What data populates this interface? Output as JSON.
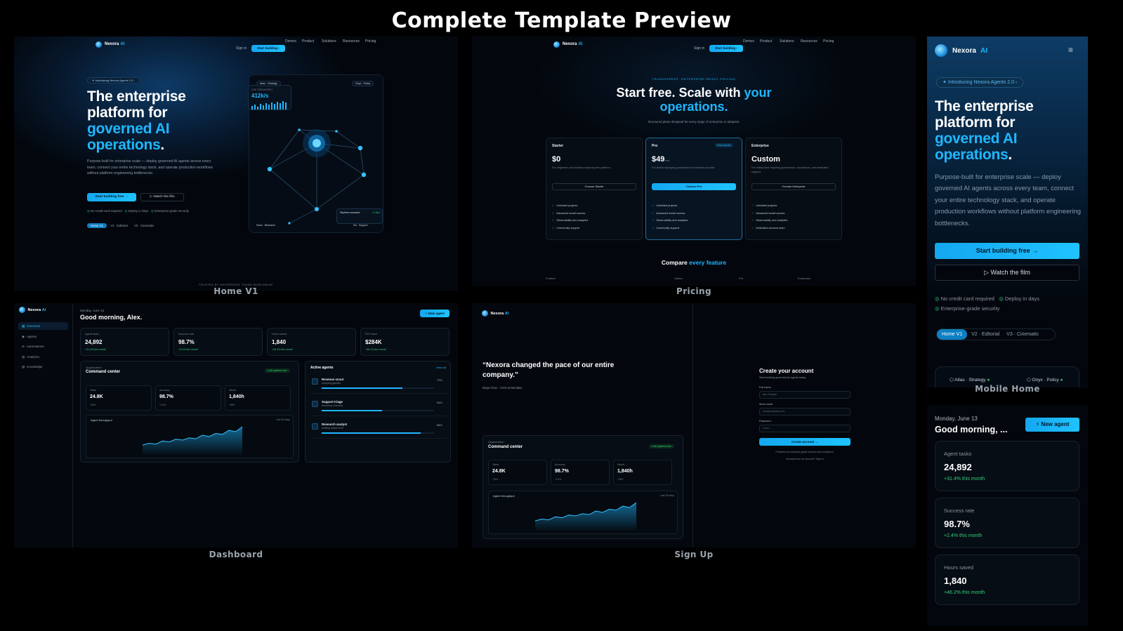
{
  "page_title": "Complete Template Preview",
  "brand": {
    "name": "Nexora",
    "suffix": "AI"
  },
  "accent": "#1fb7ff",
  "captions": {
    "home": "Home V1",
    "pricing": "Pricing",
    "dashboard": "Dashboard",
    "signup": "Sign Up",
    "mobile": "Mobile Home"
  },
  "nav": {
    "links": [
      "Demos",
      "Product",
      "Solutions",
      "Resources",
      "Pricing"
    ],
    "signin": "Sign in",
    "start": "Start building"
  },
  "home": {
    "badge": "Introducing Nexora Agents 2.0",
    "h1_a": "The enterprise",
    "h1_b": "platform for",
    "h1_c": "governed AI",
    "h1_d": "operations",
    "h1_dot": ".",
    "sub": "Purpose-built for enterprise scale — deploy governed AI agents across every team, connect your entire technology stack, and operate production workflows without platform engineering bottlenecks.",
    "cta_primary": "Start building free",
    "cta_secondary": "Watch the film",
    "checks": [
      "No credit card required",
      "Deploy in days",
      "Enterprise-grade security"
    ],
    "variants": [
      "Home V1",
      "V2 · Editorial",
      "V3 · Cinematic"
    ],
    "viz_top_left": "Atlas · Strategy",
    "viz_top_right": "Onyx · Policy",
    "viz_metric": "412k/s",
    "viz_metric_label": "LIVE THROUGHPUT",
    "viz_bottom_left": "Nova · Research",
    "viz_bottom_right": "Iris · Support",
    "viz_pipeline": "Pipeline executed",
    "viz_pipeline_badge": "+1.2k/s",
    "trusted": "TRUSTED BY ENTERPRISE TEAMS WORLDWIDE"
  },
  "pricing": {
    "eyebrow": "TRANSPARENT, ENTERPRISE-READY PRICING",
    "h_a": "Start free. Scale with",
    "h_b": "your",
    "h_c": "operations.",
    "sub": "Structured plans designed for every stage of enterprise AI adoption.",
    "plans": [
      {
        "name": "Starter",
        "price": "$0",
        "per": "",
        "desc": "For engineers and builders exploring the platform.",
        "cta": "Choose Starter",
        "featured": false,
        "features": [
          "Unlimited projects",
          "Advanced model access",
          "Observability and analytics",
          "Community support"
        ]
      },
      {
        "name": "Pro",
        "price": "$49",
        "per": "/mo",
        "desc": "For teams deploying production AI workflows at scale.",
        "cta": "Choose Pro",
        "featured": true,
        "badge": "Most popular",
        "features": [
          "Unlimited projects",
          "Advanced model access",
          "Observability and analytics",
          "Community support"
        ]
      },
      {
        "name": "Enterprise",
        "price": "Custom",
        "per": "",
        "desc": "For enterprises requiring governance, compliance, and dedicated support.",
        "cta": "Choose Enterprise",
        "featured": false,
        "features": [
          "Unlimited projects",
          "Advanced model access",
          "Observability and analytics",
          "Dedicated success team"
        ]
      }
    ],
    "compare_a": "Compare",
    "compare_b": "every feature",
    "compare_cols": [
      "Feature",
      "Starter",
      "Pro",
      "Enterprise"
    ]
  },
  "dashboard": {
    "date": "Monday, June 13",
    "greeting": "Good morning, Alex.",
    "new_agent": "New agent",
    "nav": [
      "Overview",
      "Agents",
      "Automations",
      "Analytics",
      "Knowledge"
    ],
    "stats": [
      {
        "label": "Agent tasks",
        "value": "24,892",
        "delta": "+31.4% this month"
      },
      {
        "label": "Success rate",
        "value": "98.7%",
        "delta": "+2.4% this month"
      },
      {
        "label": "Hours saved",
        "value": "1,840",
        "delta": "+46.2% this month"
      },
      {
        "label": "ROI value",
        "value": "$284K",
        "delta": "+58.1% this month"
      }
    ],
    "command_eyebrow": "Organization",
    "command_title": "Command center",
    "command_badge": "All systems live",
    "command_metrics": [
      {
        "label": "Tasks",
        "value": "24.8K",
        "delta": "+31%"
      },
      {
        "label": "Accuracy",
        "value": "98.7%",
        "delta": "+2.4%"
      },
      {
        "label": "Saved",
        "value": "1,840h",
        "delta": "+46%"
      }
    ],
    "throughput_label": "Agent throughput",
    "throughput_range": "Last 30 days",
    "throughput_series": [
      22,
      26,
      24,
      31,
      29,
      35,
      33,
      38,
      36,
      44,
      41,
      48,
      46,
      55,
      52,
      63
    ],
    "active_title": "Active agents",
    "active_link": "View all",
    "agents": [
      {
        "name": "Revenue scout",
        "role": "Analyzing pipeline",
        "pct": "72%",
        "progress": 0.72
      },
      {
        "name": "Support triage",
        "role": "Resolving 18 tickets",
        "pct": "54%",
        "progress": 0.54
      },
      {
        "name": "Research analyst",
        "role": "Drafting market brief",
        "pct": "88%",
        "progress": 0.88
      }
    ]
  },
  "signup": {
    "quote": "“Nexora changed the pace of our entire company.”",
    "attribution": "Maya Chen · COO at Meridian",
    "title": "Create your account",
    "subtitle": "Start building governed AI agents today.",
    "fields": [
      {
        "label": "Full name",
        "placeholder": "Alex Morgan"
      },
      {
        "label": "Work email",
        "placeholder": "you@company.com"
      },
      {
        "label": "Password",
        "placeholder": "••••••••"
      }
    ],
    "cta": "Create account",
    "terms": "Protected by enterprise-grade security and compliance.",
    "signin_prompt": "Already have an account? Sign in"
  },
  "mobile": {
    "badge": "Introducing Nexora Agents 2.0",
    "cta_primary": "Start building free",
    "cta_secondary": "Watch the film",
    "checks": [
      "No credit card required",
      "Deploy in days",
      "Enterprise-grade security"
    ],
    "greeting": "Good morning, ...",
    "viz_left": "Atlas · Strategy",
    "viz_right": "Onyx · Policy"
  }
}
